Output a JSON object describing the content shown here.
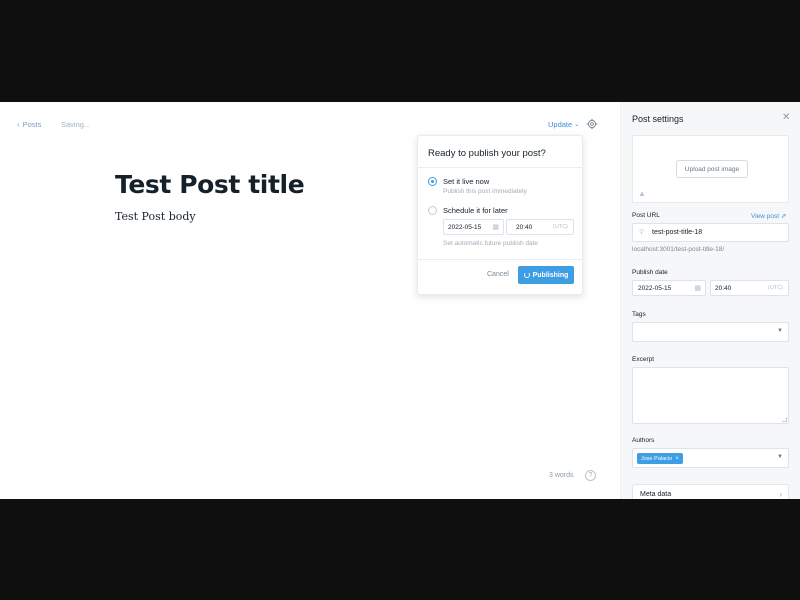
{
  "editor": {
    "back_label": "Posts",
    "save_status": "Saving...",
    "update_label": "Update",
    "title": "Test Post title",
    "body": "Test Post body",
    "word_count": "3 words",
    "help_symbol": "?"
  },
  "publish_menu": {
    "title": "Ready to publish your post?",
    "option_now_label": "Set it live now",
    "option_now_sub": "Publish this post immediately",
    "option_later_label": "Schedule it for later",
    "option_later_sub": "Set automatic future publish date",
    "date_value": "2022-05-15",
    "time_value": "20:40",
    "timezone": "(UTC)",
    "selected_option": "now",
    "cancel_label": "Cancel",
    "publish_label": "Publishing"
  },
  "sidebar": {
    "title": "Post settings",
    "upload_label": "Upload post image",
    "post_url_label": "Post URL",
    "view_post_label": "View post ⇗",
    "slug": "test-post-title-18",
    "url_preview": "localhost:3001/test-post-title-18/",
    "publish_date_label": "Publish date",
    "date_value": "2022-05-15",
    "time_value": "20:40",
    "timezone": "(UTC)",
    "tags_label": "Tags",
    "excerpt_label": "Excerpt",
    "authors_label": "Authors",
    "authors": [
      "Jose Palacio"
    ],
    "meta_data_label": "Meta data"
  },
  "colors": {
    "accent": "#3e9ee3",
    "text": "#15212a",
    "letterbox": "#0f0f10"
  }
}
